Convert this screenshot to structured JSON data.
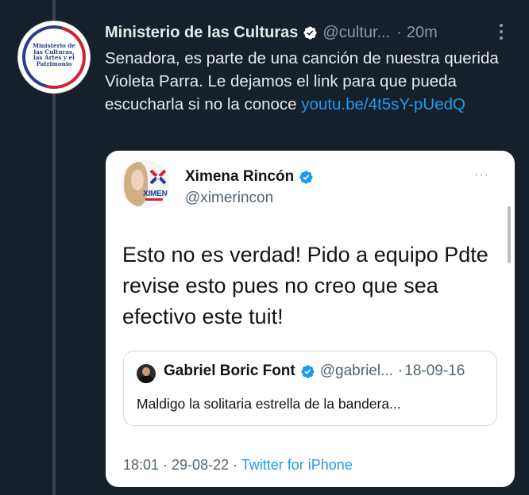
{
  "tweet": {
    "display_name": "Ministerio de las Culturas",
    "handle": "@cultur...",
    "separator": "·",
    "time": "20m",
    "text": "Senadora, es parte de una canción de nuestra querida Violeta Parra. Le dejamos el link para que pueda escucharla si no la conoce ",
    "link": "youtu.be/4t5sY-pUedQ",
    "avatar_text": "Ministerio de\nlas Culturas,\nlas Artes y el\nPatrimonio"
  },
  "quoted": {
    "display_name": "Ximena Rincón",
    "handle": "@ximerincon",
    "menu": "···",
    "avatar_logo": "XIMENA",
    "text": "Esto no es verdad! Pido a equipo Pdte revise esto pues no creo que sea efectivo este tuit!",
    "footer_time": "18:01 · 29-08-22 · ",
    "footer_client": "Twitter for iPhone"
  },
  "inner_quote": {
    "display_name": "Gabriel Boric Font",
    "handle": "@gabriel...",
    "separator": "·",
    "date": "18-09-16",
    "text": "Maldigo la solitaria estrella de la bandera..."
  },
  "colors": {
    "background": "#15202b",
    "link": "#1d9bf0",
    "verified": "#1d9bf0",
    "muted": "#8b98a5",
    "card": "#ffffff"
  }
}
